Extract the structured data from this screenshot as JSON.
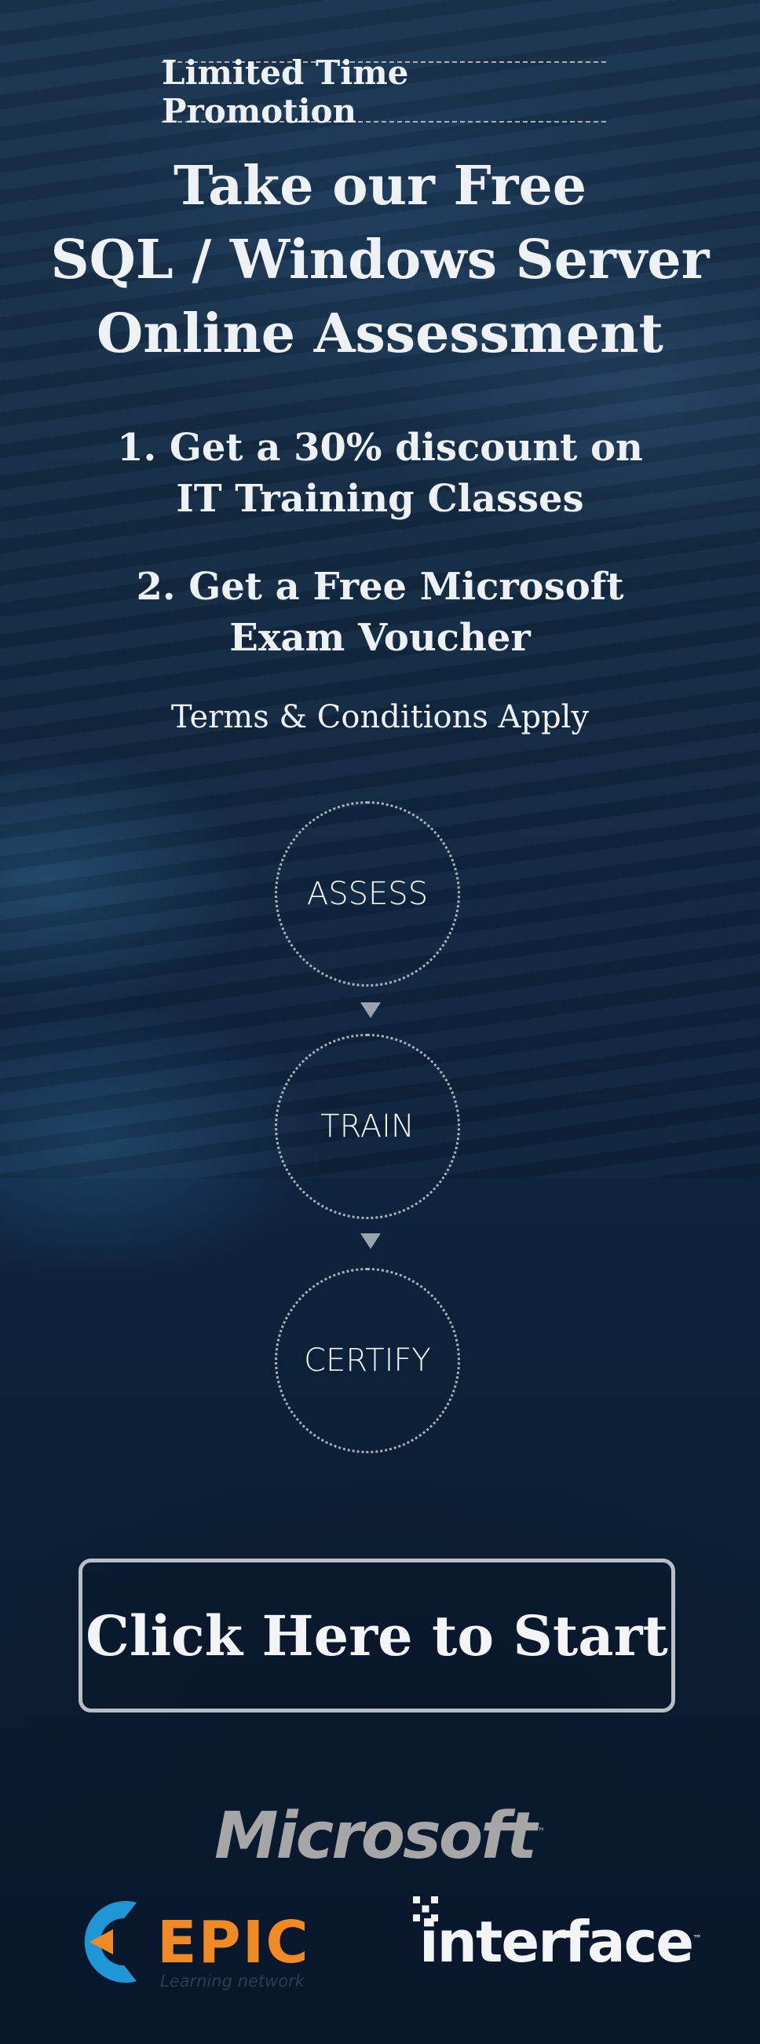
{
  "promo_label": "Limited Time Promotion",
  "headline": [
    "Take our Free",
    "SQL / Windows Server",
    "Online Assessment"
  ],
  "benefits": [
    [
      "1. Get a 30% discount on",
      "IT Training Classes"
    ],
    [
      "2. Get a Free Microsoft",
      "Exam Voucher"
    ]
  ],
  "terms": "Terms & Conditions Apply",
  "steps": [
    "ASSESS",
    "TRAIN",
    "CERTIFY"
  ],
  "cta_label": "Click Here to Start",
  "logos": {
    "microsoft": "Microsoft",
    "epic_name": "EPIC",
    "epic_tagline": "Learning network",
    "interface_name": "interface"
  },
  "colors": {
    "epic_orange": "#f08a24",
    "epic_blue": "#1f97d6",
    "text_light": "#eef1f4"
  }
}
